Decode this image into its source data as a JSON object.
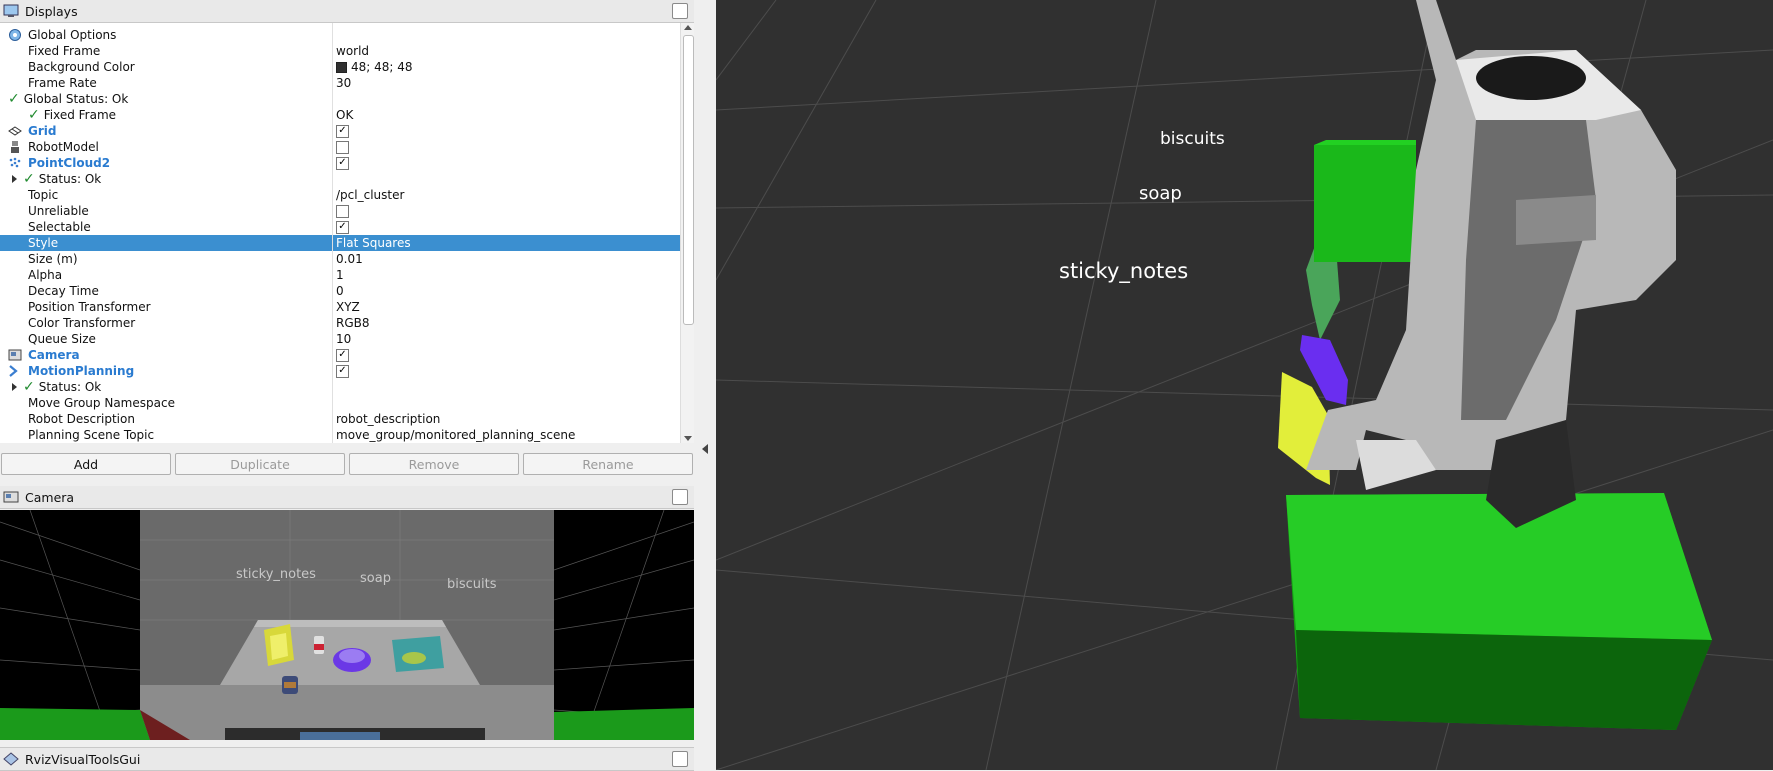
{
  "colors": {
    "selection": "#3b8fd0",
    "accent_blue": "#2a7bd0",
    "ok_green": "#1f8a2e",
    "viewport_bg": "#303030",
    "box_green": "#1cc21c"
  },
  "displays_panel": {
    "title": "Displays"
  },
  "tree": [
    {
      "prop": "Global Options",
      "val": "",
      "indent": 0,
      "icon": "globe-icon"
    },
    {
      "prop": "Fixed Frame",
      "val": "world",
      "indent": 1
    },
    {
      "prop": "Background Color",
      "val": "48; 48; 48",
      "indent": 1,
      "swatch": true
    },
    {
      "prop": "Frame Rate",
      "val": "30",
      "indent": 1
    },
    {
      "prop": "Global Status: Ok",
      "val": "",
      "indent": 0,
      "status": true
    },
    {
      "prop": "Fixed Frame",
      "val": "OK",
      "indent": 1,
      "status": true
    },
    {
      "prop": "Grid",
      "val": "",
      "indent": 0,
      "icon": "grid-icon",
      "bold": true,
      "checkbox": true
    },
    {
      "prop": "RobotModel",
      "val": "",
      "indent": 0,
      "icon": "robot-icon",
      "checkbox": false
    },
    {
      "prop": "PointCloud2",
      "val": "",
      "indent": 0,
      "icon": "pointcloud-icon",
      "bold": true,
      "checkbox": true
    },
    {
      "prop": "Status: Ok",
      "val": "",
      "indent": 1,
      "status": true,
      "expand": true
    },
    {
      "prop": "Topic",
      "val": "/pcl_cluster",
      "indent": 1
    },
    {
      "prop": "Unreliable",
      "val": "",
      "indent": 1,
      "checkbox": false
    },
    {
      "prop": "Selectable",
      "val": "",
      "indent": 1,
      "checkbox": true
    },
    {
      "prop": "Style",
      "val": "Flat Squares",
      "indent": 1,
      "selected": true
    },
    {
      "prop": "Size (m)",
      "val": "0.01",
      "indent": 1
    },
    {
      "prop": "Alpha",
      "val": "1",
      "indent": 1
    },
    {
      "prop": "Decay Time",
      "val": "0",
      "indent": 1
    },
    {
      "prop": "Position Transformer",
      "val": "XYZ",
      "indent": 1
    },
    {
      "prop": "Color Transformer",
      "val": "RGB8",
      "indent": 1
    },
    {
      "prop": "Queue Size",
      "val": "10",
      "indent": 1
    },
    {
      "prop": "Camera",
      "val": "",
      "indent": 0,
      "icon": "camera-icon",
      "bold": true,
      "checkbox": true
    },
    {
      "prop": "MotionPlanning",
      "val": "",
      "indent": 0,
      "icon": "motion-planning-icon",
      "bold": true,
      "checkbox": true
    },
    {
      "prop": "Status: Ok",
      "val": "",
      "indent": 1,
      "status": true,
      "expand": true
    },
    {
      "prop": "Move Group Namespace",
      "val": "",
      "indent": 1
    },
    {
      "prop": "Robot Description",
      "val": "robot_description",
      "indent": 1
    },
    {
      "prop": "Planning Scene Topic",
      "val": "move_group/monitored_planning_scene",
      "indent": 1
    }
  ],
  "buttons": {
    "add": "Add",
    "duplicate": "Duplicate",
    "remove": "Remove",
    "rename": "Rename"
  },
  "camera_panel": {
    "title": "Camera",
    "labels": [
      "sticky_notes",
      "soap",
      "biscuits"
    ]
  },
  "rviz_tools_panel": {
    "title": "RvizVisualToolsGui"
  },
  "viewport_labels": {
    "biscuits": "biscuits",
    "soap": "soap",
    "sticky_notes": "sticky_notes"
  }
}
